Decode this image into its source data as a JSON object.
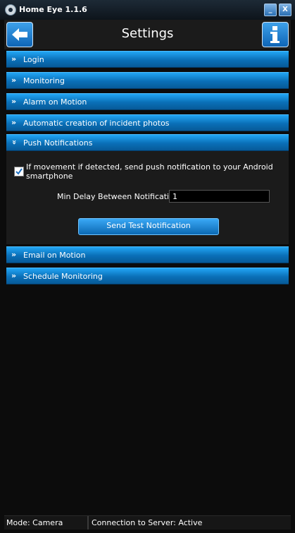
{
  "window": {
    "title": "Home Eye 1.1.6",
    "minimize_glyph": "_",
    "close_glyph": "X"
  },
  "header": {
    "title": "Settings",
    "back_icon": "arrow-left-icon",
    "info_icon": "info-icon"
  },
  "sections": [
    {
      "label": "Login",
      "expanded": false,
      "chevron": "»"
    },
    {
      "label": "Monitoring",
      "expanded": false,
      "chevron": "»"
    },
    {
      "label": "Alarm on Motion",
      "expanded": false,
      "chevron": "»"
    },
    {
      "label": "Automatic creation of incident photos",
      "expanded": false,
      "chevron": "»"
    },
    {
      "label": "Push Notifications",
      "expanded": true,
      "chevron": "»"
    },
    {
      "label": "Email on Motion",
      "expanded": false,
      "chevron": "»"
    },
    {
      "label": "Schedule Monitoring",
      "expanded": false,
      "chevron": "»"
    }
  ],
  "push_notifications": {
    "checkbox_label": "If movement if detected, send push notification to your Android smartphone",
    "checkbox_checked": true,
    "delay_label": "Min Delay Between Notifications",
    "delay_value": "1",
    "test_button_label": "Send Test Notification"
  },
  "status": {
    "mode": "Mode: Camera",
    "connection": "Connection to Server: Active"
  },
  "colors": {
    "accent": "#0a6fb7",
    "accent_light": "#22a6f5",
    "background": "#0c0c0c",
    "panel": "#1b1b1b"
  }
}
